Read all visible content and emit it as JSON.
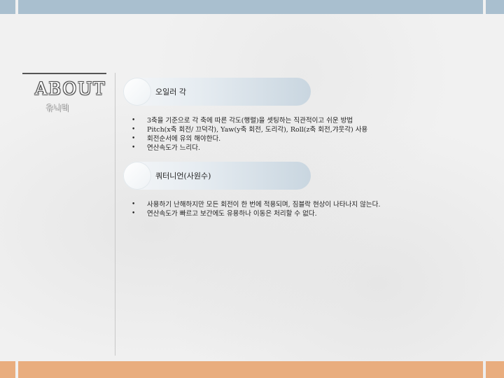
{
  "sidebar": {
    "title": "ABOUT",
    "subtitle": "유니티"
  },
  "sections": [
    {
      "header": "오일러 각",
      "bullets": [
        "3축을 기준으로 각 축에 따른 각도(행렬)을 셋팅하는 직관적이고 쉬운 방법",
        "Pitch(x축 회전/ 끄덕각), Yaw(y축 회전, 도리각), Roll(z축 회전,갸웃각) 사용",
        "회전순서에 유의 해야한다.",
        "연산속도가 느리다."
      ]
    },
    {
      "header": "쿼터니언(사원수)",
      "bullets": [
        "사용하기 난해하지만 모든 회전이 한 번에 적용되며, 짐블락 현상이 나타나지 않는다.",
        "연산속도가 빠르고 보간에도 유용하나 이동은 처리할 수 없다."
      ]
    }
  ],
  "bullet_glyph": "•",
  "colors": {
    "top_bar": "#a9bfcf",
    "bottom_bar": "#e9ad7e",
    "background": "#f1f1f1"
  }
}
